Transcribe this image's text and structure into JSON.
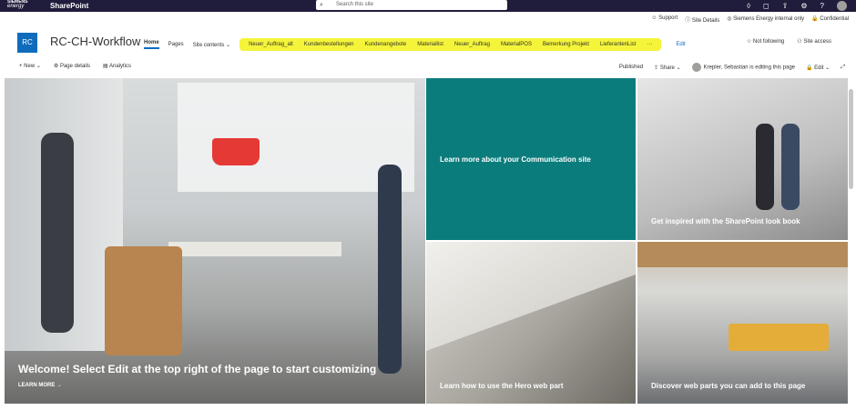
{
  "topbar": {
    "logo_line1": "SIEMENS",
    "logo_line2": "energy",
    "app_name": "SharePoint",
    "search_placeholder": "Search this site"
  },
  "infobar": {
    "support": "Support",
    "site_details": "Site Details",
    "internal": "Siemens Energy internal only",
    "confidential": "Confidential"
  },
  "site": {
    "icon": "RC",
    "title": "RC-CH-Workflow"
  },
  "nav": {
    "home": "Home",
    "pages": "Pages",
    "site_contents": "Site contents",
    "links": [
      "Neuer_Auftrag_alt",
      "Kundenbestellungen",
      "Kundenangebote",
      "Materiallist",
      "Neuer_Auftrag",
      "MaterialPOS",
      "Bemerkung Projekt",
      "LieferantenList",
      "···"
    ],
    "edit": "Edit",
    "not_following": "Not following",
    "site_access": "Site access"
  },
  "cmdbar": {
    "new": "New",
    "page_details": "Page details",
    "analytics": "Analytics",
    "published": "Published",
    "share": "Share",
    "editing": "Krepler, Sebastian is editing this page",
    "edit": "Edit"
  },
  "hero": {
    "main_caption": "Welcome! Select Edit at the top right of the page to start customizing",
    "learn_more": "LEARN MORE →",
    "tile1": "Learn more about your Communication site",
    "tile2": "Get inspired with the SharePoint look book",
    "tile3": "Learn how to use the Hero web part",
    "tile4": "Discover web parts you can add to this page"
  },
  "colors": {
    "suite_bar": "#201c3b",
    "accent": "#0f6cbd",
    "teal_tile": "#0b7c7c",
    "highlight": "#f4f43a"
  }
}
